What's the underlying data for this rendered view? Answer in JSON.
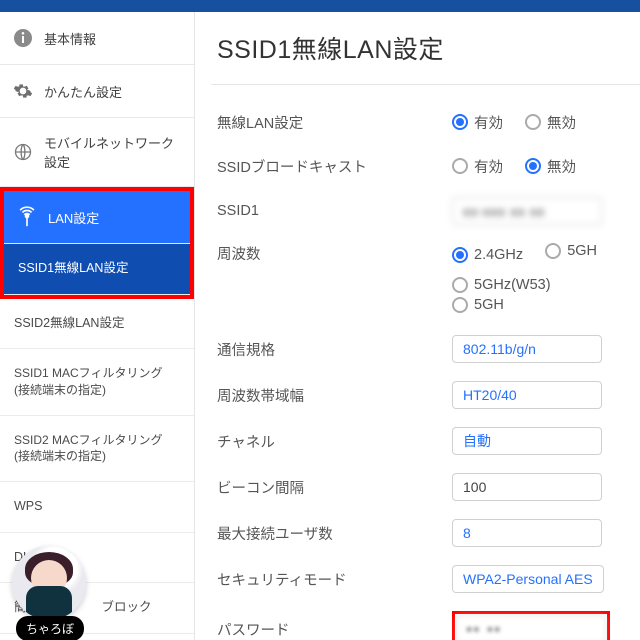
{
  "sidebar": {
    "basic": "基本情報",
    "easy": "かんたん設定",
    "mobile": "モバイルネットワーク設定",
    "lan": "LAN設定",
    "sub": {
      "ssid1": "SSID1無線LAN設定",
      "ssid2": "SSID2無線LAN設定",
      "ssid1mac_a": "SSID1 MACフィルタリング",
      "ssid1mac_b": "(接続端末の指定)",
      "ssid2mac_a": "SSID2 MACフィルタリング",
      "ssid2mac_b": "(接続端末の指定)",
      "wps": "WPS",
      "dhcp": "DH",
      "block": "簡易　　　　　ブロック"
    }
  },
  "title": "SSID1無線LAN設定",
  "rows": {
    "wlan": "無線LAN設定",
    "broadcast": "SSIDブロードキャスト",
    "ssid1": "SSID1",
    "freq": "周波数",
    "standard": "通信規格",
    "bandwidth": "周波数帯域幅",
    "channel": "チャネル",
    "beacon": "ビーコン間隔",
    "maxusers": "最大接続ユーザ数",
    "security": "セキュリティモード",
    "password": "パスワード"
  },
  "opts": {
    "enable": "有効",
    "disable": "無効",
    "g24": "2.4GHz",
    "g5": "5GH",
    "g5w53": "5GHz(W53)",
    "g5b": "5GH"
  },
  "vals": {
    "ssid1": "xx-xxx  xx  xx",
    "standard": "802.11b/g/n",
    "bandwidth": "HT20/40",
    "channel": "自動",
    "beacon": "100",
    "maxusers": "8",
    "security": "WPA2-Personal AES",
    "password": "▪▪   ▪▪"
  },
  "avatar": {
    "name": "ちゃろぼ"
  }
}
